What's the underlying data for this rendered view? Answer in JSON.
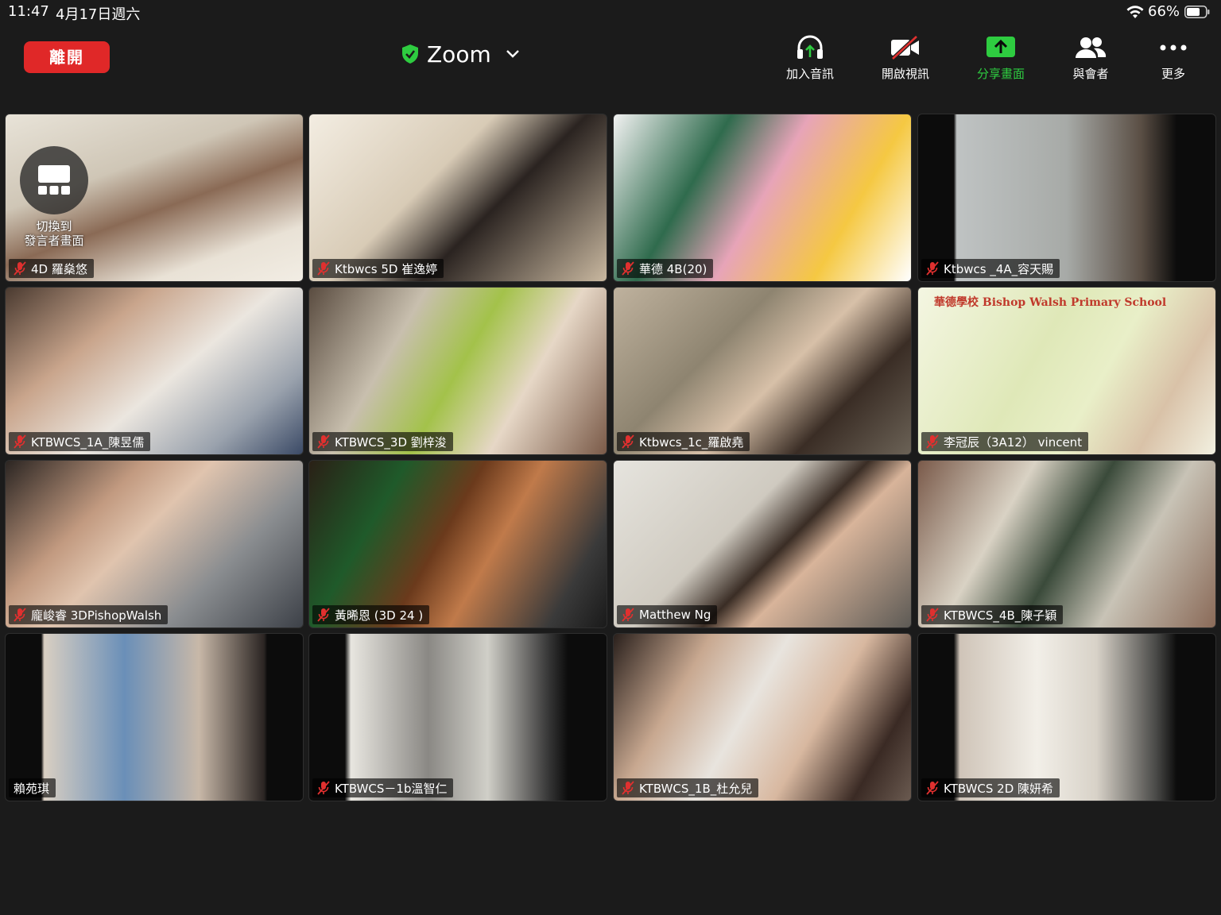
{
  "status_bar": {
    "time": "11:47",
    "date": "4月17日週六",
    "battery_percent": "66%"
  },
  "toolbar": {
    "leave_label": "離開",
    "meeting_title": "Zoom",
    "join_audio_label": "加入音訊",
    "start_video_label": "開啟視訊",
    "share_screen_label": "分享畫面",
    "participants_label": "與會者",
    "more_label": "更多"
  },
  "switch_view": {
    "line1": "切換到",
    "line2": "發言者畫面"
  },
  "participants": [
    {
      "name": "4D 羅燊悠",
      "muted": true
    },
    {
      "name": "Ktbwcs 5D 崔逸婷",
      "muted": true
    },
    {
      "name": "華德 4B(20)",
      "muted": true
    },
    {
      "name": "Ktbwcs _4A_容天賜",
      "muted": true
    },
    {
      "name": "KTBWCS_1A_陳昱儒",
      "muted": true
    },
    {
      "name": "KTBWCS_3D 劉梓浚",
      "muted": true
    },
    {
      "name": "Ktbwcs_1c_羅啟堯",
      "muted": true
    },
    {
      "name": "李冠辰（3A12） vincent",
      "muted": true
    },
    {
      "name": "龐峻睿 3DPishopWalsh",
      "muted": true
    },
    {
      "name": "黃晞恩 (3D 24 )",
      "muted": true
    },
    {
      "name": "Matthew Ng",
      "muted": true
    },
    {
      "name": "KTBWCS_4B_陳子穎",
      "muted": true
    },
    {
      "name": "賴苑琪",
      "muted": false
    },
    {
      "name": "KTBWCS－1b溫智仁",
      "muted": true
    },
    {
      "name": "KTBWCS_1B_杜允兒",
      "muted": true
    },
    {
      "name": "KTBWCS 2D 陳妍希",
      "muted": true
    }
  ],
  "tile8_banner": "華德學校 Bishop Walsh Primary School",
  "colors": {
    "background": "#1b1b1b",
    "leave": "#e02828",
    "share": "#2ecc40",
    "mute": "#e0302f"
  }
}
